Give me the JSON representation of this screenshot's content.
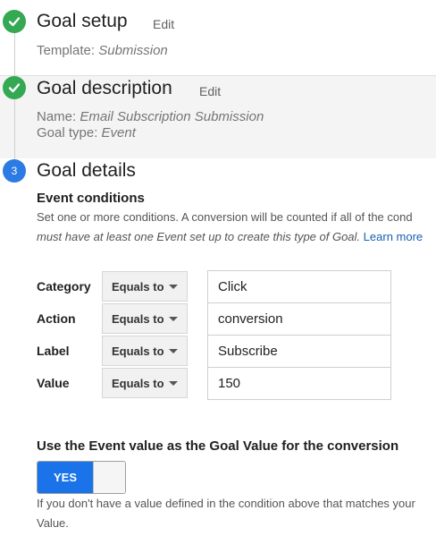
{
  "steps": {
    "step1": {
      "title": "Goal setup",
      "edit_label": "Edit",
      "template_label": "Template:",
      "template_value": "Submission"
    },
    "step2": {
      "title": "Goal description",
      "edit_label": "Edit",
      "name_label": "Name:",
      "name_value": "Email Subscription Submission",
      "goal_type_label": "Goal type:",
      "goal_type_value": "Event"
    },
    "step3": {
      "number": "3",
      "title": "Goal details",
      "event_conditions_heading": "Event conditions",
      "desc_line1": "Set one or more conditions. A conversion will be counted if all of the cond",
      "desc_line2_italic": "must have at least one Event set up to create this type of Goal.",
      "learn_more": "Learn more"
    }
  },
  "conditions": [
    {
      "label": "Category",
      "operator": "Equals to",
      "value": "Click"
    },
    {
      "label": "Action",
      "operator": "Equals to",
      "value": "conversion"
    },
    {
      "label": "Label",
      "operator": "Equals to",
      "value": "Subscribe"
    },
    {
      "label": "Value",
      "operator": "Equals to",
      "value": "150"
    }
  ],
  "goal_value": {
    "heading": "Use the Event value as the Goal Value for the conversion",
    "toggle_label": "YES",
    "toggle_state": "on",
    "help_line1": "If you don't have a value defined in the condition above that matches your",
    "help_line2": "Value."
  },
  "colors": {
    "done": "#34a853",
    "current": "#2c7be5",
    "toggle_on": "#1a73e8",
    "link": "#1a5fb4"
  }
}
